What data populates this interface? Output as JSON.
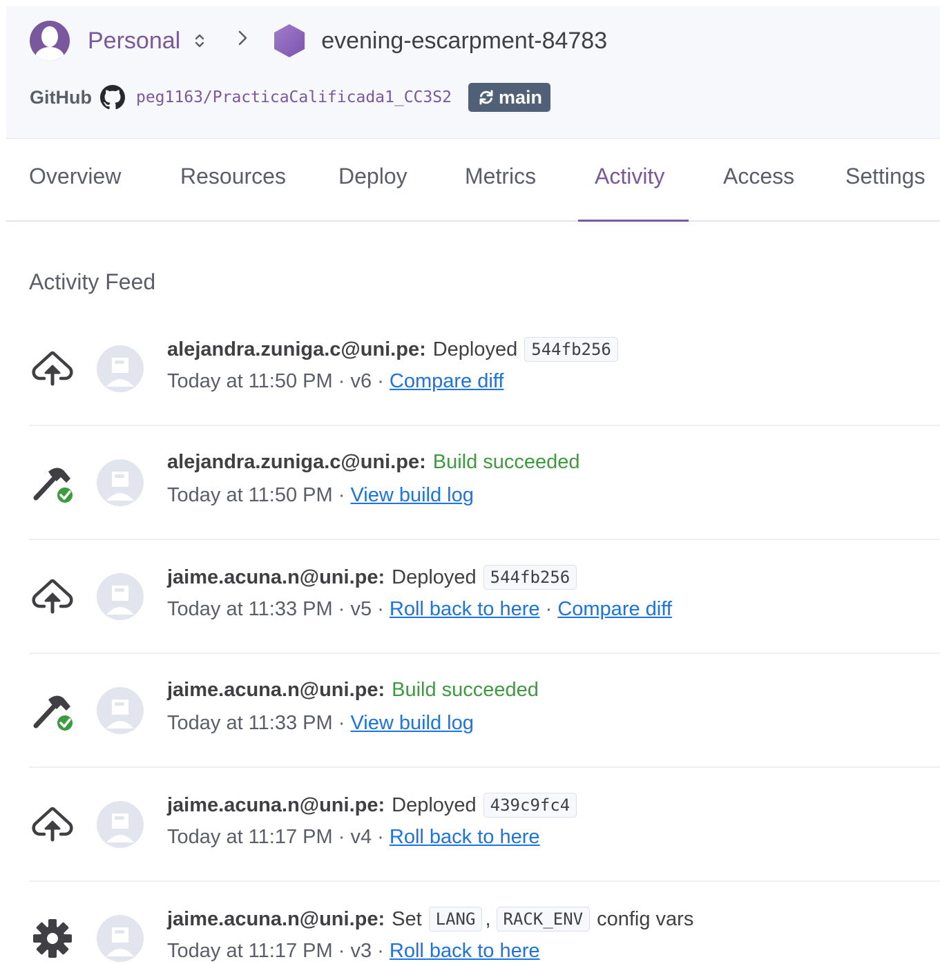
{
  "header": {
    "account": "Personal",
    "app_name": "evening-escarpment-84783",
    "github_label": "GitHub",
    "repo": "peg1163/PracticaCalificada1_CC3S2",
    "branch": "main",
    "colors": {
      "brand": "#79589f",
      "branch_badge": "#4f6077",
      "header_bg": "#f7f8fb"
    }
  },
  "tabs": [
    {
      "label": "Overview"
    },
    {
      "label": "Resources"
    },
    {
      "label": "Deploy"
    },
    {
      "label": "Metrics"
    },
    {
      "label": "Activity",
      "active": true
    },
    {
      "label": "Access"
    },
    {
      "label": "Settings"
    }
  ],
  "feed": {
    "title": "Activity Feed",
    "items": [
      {
        "icon": "deploy-icon",
        "user": "alejandra.zuniga.c@uni.pe:",
        "action": "Deployed",
        "code": "544fb256",
        "time": "Today at 11:50 PM",
        "version": "v6",
        "link1": "Compare diff"
      },
      {
        "icon": "build-icon",
        "user": "alejandra.zuniga.c@uni.pe:",
        "action": "Build succeeded",
        "time": "Today at 11:50 PM",
        "link1": "View build log"
      },
      {
        "icon": "deploy-icon",
        "user": "jaime.acuna.n@uni.pe:",
        "action": "Deployed",
        "code": "544fb256",
        "time": "Today at 11:33 PM",
        "version": "v5",
        "link1": "Roll back to here",
        "link2": "Compare diff"
      },
      {
        "icon": "build-icon",
        "user": "jaime.acuna.n@uni.pe:",
        "action": "Build succeeded",
        "time": "Today at 11:33 PM",
        "link1": "View build log"
      },
      {
        "icon": "deploy-icon",
        "user": "jaime.acuna.n@uni.pe:",
        "action": "Deployed",
        "code": "439c9fc4",
        "time": "Today at 11:17 PM",
        "version": "v4",
        "link1": "Roll back to here"
      },
      {
        "icon": "gear-icon",
        "user": "jaime.acuna.n@uni.pe:",
        "action": "Set",
        "code": "LANG",
        "comma": ",",
        "code2": "RACK_ENV",
        "after": "config vars",
        "time": "Today at 11:17 PM",
        "version": "v3",
        "link1": "Roll back to here"
      }
    ]
  }
}
